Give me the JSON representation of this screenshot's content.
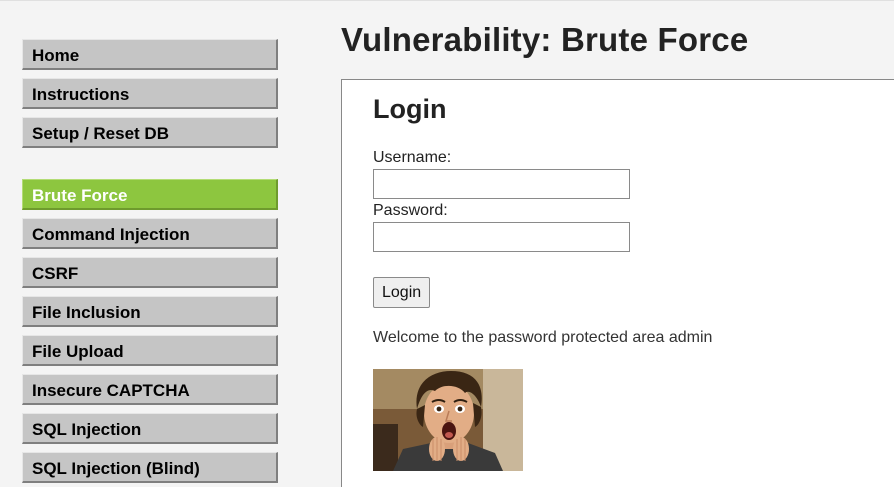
{
  "header": {
    "title": "Vulnerability: Brute Force"
  },
  "sidebar": {
    "group1": [
      {
        "label": "Home"
      },
      {
        "label": "Instructions"
      },
      {
        "label": "Setup / Reset DB"
      }
    ],
    "group2": [
      {
        "label": "Brute Force",
        "active": true
      },
      {
        "label": "Command Injection"
      },
      {
        "label": "CSRF"
      },
      {
        "label": "File Inclusion"
      },
      {
        "label": "File Upload"
      },
      {
        "label": "Insecure CAPTCHA"
      },
      {
        "label": "SQL Injection"
      },
      {
        "label": "SQL Injection (Blind)"
      }
    ]
  },
  "login": {
    "heading": "Login",
    "username_label": "Username:",
    "username_value": "",
    "password_label": "Password:",
    "password_value": "",
    "button_label": "Login",
    "message": "Welcome to the password protected area admin"
  },
  "colors": {
    "active_item": "#8dc63f",
    "menu_item": "#c5c5c5",
    "page_background": "#f4f4f4"
  }
}
